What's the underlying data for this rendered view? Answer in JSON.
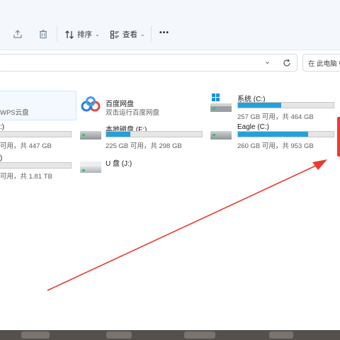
{
  "toolbar": {
    "sort_label": "排序",
    "view_label": "查看",
    "more_label": "•••"
  },
  "search": {
    "placeholder": "在 此电脑 中"
  },
  "items": [
    {
      "name": "",
      "sub": "WPS云盘"
    },
    {
      "name": "百度网盘",
      "sub": "双击运行百度网盘"
    },
    {
      "name": "系统 (C:)",
      "sub": "257 GB 可用，共 464 GB",
      "fill": 0.45
    },
    {
      "name": ":)",
      "sub": "可用，共 447 GB",
      "fill": 0.0
    },
    {
      "name": "本地磁盘 (F:)",
      "sub": "225 GB 可用，共 298 GB",
      "fill": 0.25
    },
    {
      "name": "Eagle (C:)",
      "sub": "260 GB 可用，共 953 GB",
      "fill": 0.73
    },
    {
      "name": ")",
      "sub": "可用，共 1.81 TB",
      "fill": 0.0
    },
    {
      "name": "U 盘 (J:)",
      "sub": ""
    }
  ],
  "colors": {
    "accent": "#26a0da",
    "annotation": "#e93b2e"
  }
}
